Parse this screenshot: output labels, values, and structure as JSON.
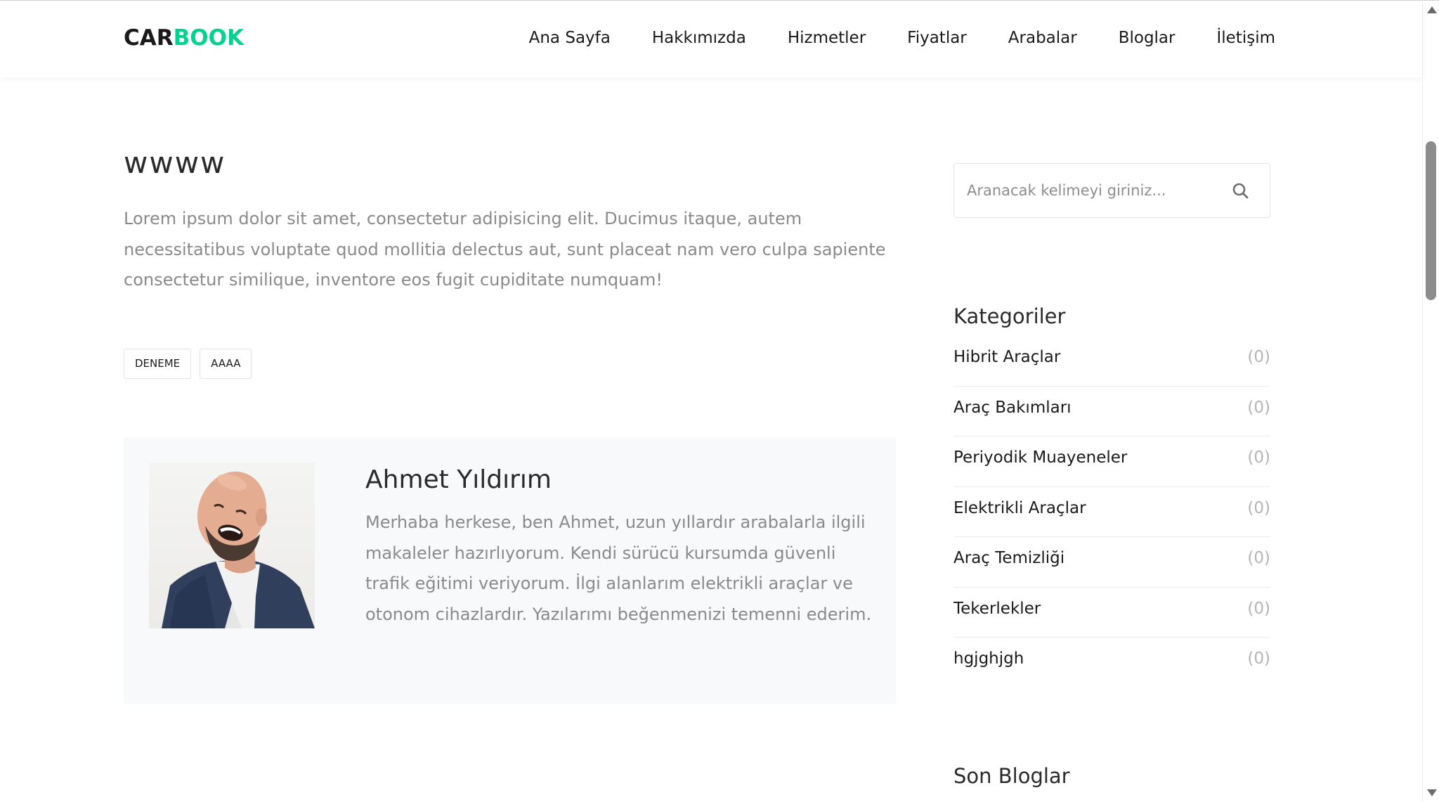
{
  "navbar": {
    "logo_part1": "CAR",
    "logo_part2": "BOOK",
    "items": [
      {
        "label": "Ana Sayfa"
      },
      {
        "label": "Hakkımızda"
      },
      {
        "label": "Hizmetler"
      },
      {
        "label": "Fiyatlar"
      },
      {
        "label": "Arabalar"
      },
      {
        "label": "Bloglar"
      },
      {
        "label": "İletişim"
      }
    ]
  },
  "post": {
    "title": "wwww",
    "body": "Lorem ipsum dolor sit amet, consectetur adipisicing elit. Ducimus itaque, autem necessitatibus voluptate quod mollitia delectus aut, sunt placeat nam vero culpa sapiente consectetur similique, inventore eos fugit cupiditate numquam!",
    "tags": [
      "DENEME",
      "AAAA"
    ]
  },
  "author": {
    "name": "Ahmet Yıldırım",
    "bio": "Merhaba herkese, ben Ahmet, uzun yıllardır arabalarla ilgili makaleler hazırlıyorum. Kendi sürücü kursumda güvenli trafik eğitimi veriyorum. İlgi alanlarım elektrikli araçlar ve otonom cihazlardır. Yazılarımı beğenmenizi temenni ederim."
  },
  "sidebar": {
    "search": {
      "placeholder": "Aranacak kelimeyi giriniz...",
      "value": ""
    },
    "categories_title": "Kategoriler",
    "categories": [
      {
        "label": "Hibrit Araçlar",
        "count": "(0)"
      },
      {
        "label": "Araç Bakımları",
        "count": "(0)"
      },
      {
        "label": "Periyodik Muayeneler",
        "count": "(0)"
      },
      {
        "label": "Elektrikli Araçlar",
        "count": "(0)"
      },
      {
        "label": "Araç Temizliği",
        "count": "(0)"
      },
      {
        "label": "Tekerlekler",
        "count": "(0)"
      },
      {
        "label": "hgjghjgh",
        "count": "(0)"
      }
    ],
    "recent_title": "Son Bloglar"
  },
  "icons": {
    "search": "search-icon",
    "scroll_up": "arrow-up-icon",
    "scroll_down": "arrow-down-icon"
  },
  "colors": {
    "brand_dark": "#1a1a1a",
    "brand_accent": "#01d28e",
    "text_muted": "#8a8a8a",
    "author_box_bg": "#f8f9fa"
  }
}
